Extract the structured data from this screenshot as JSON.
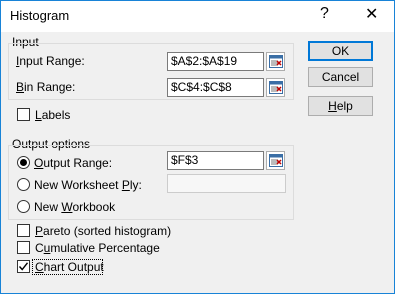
{
  "window": {
    "title": "Histogram",
    "help_glyph": "?",
    "close_glyph": "✕"
  },
  "input_group": {
    "label": "Input",
    "input_range": {
      "label_key": "I",
      "label_rest": "nput Range:",
      "value": "$A$2:$A$19"
    },
    "bin_range": {
      "label_key": "B",
      "label_rest": "in Range:",
      "value": "$C$4:$C$8"
    },
    "labels_checkbox": {
      "label_key": "L",
      "label_rest": "abels",
      "checked": false
    }
  },
  "output_group": {
    "label": "Output options",
    "output_range": {
      "label_key": "O",
      "label_rest": "utput Range:",
      "value": "$F$3",
      "selected": true
    },
    "new_worksheet": {
      "label_pre": "New Worksheet ",
      "label_key": "P",
      "label_rest": "ly:",
      "value": "",
      "selected": false
    },
    "new_workbook": {
      "label_pre": "New ",
      "label_key": "W",
      "label_rest": "orkbook",
      "selected": false
    }
  },
  "options": {
    "pareto": {
      "label_key": "P",
      "label_rest": "areto (sorted histogram)",
      "checked": false
    },
    "cumulative": {
      "label_pre": "C",
      "label_key": "u",
      "label_rest": "mulative Percentage",
      "checked": false
    },
    "chart_output": {
      "label_key": "C",
      "label_rest": "hart Output",
      "checked": true
    }
  },
  "buttons": {
    "ok": "OK",
    "cancel": "Cancel",
    "help_key": "H",
    "help_rest": "elp"
  },
  "colors": {
    "accent": "#0078d7",
    "border": "#1883d7",
    "dialog_bg": "#f0f0f0"
  },
  "icons": {
    "ref_button": "collapse-dialog-icon",
    "checkmark": "checkmark-icon"
  }
}
